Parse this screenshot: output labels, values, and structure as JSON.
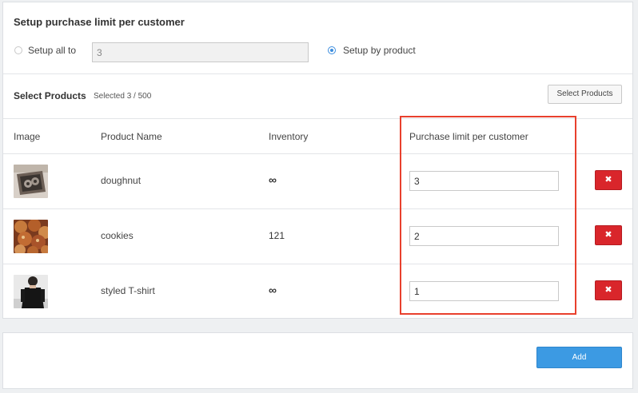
{
  "header": {
    "title": "Setup purchase limit per customer",
    "option_all_label": "Setup all to",
    "option_all_value": "3",
    "option_product_label": "Setup by product",
    "selected_option": "by_product"
  },
  "products": {
    "title": "Select Products",
    "count": "Selected 3 / 500",
    "select_button": "Select Products"
  },
  "table": {
    "columns": [
      "Image",
      "Product Name",
      "Inventory",
      "Purchase limit per customer"
    ],
    "rows": [
      {
        "name": "doughnut",
        "inventory": "∞",
        "limit": "3",
        "delete": "✖"
      },
      {
        "name": "cookies",
        "inventory": "121",
        "limit": "2",
        "delete": "✖"
      },
      {
        "name": "styled T-shirt",
        "inventory": "∞",
        "limit": "1",
        "delete": "✖"
      }
    ]
  },
  "footer": {
    "add_button": "Add"
  },
  "colors": {
    "accent_blue": "#3c9ae3",
    "delete_red": "#d9262b",
    "highlight_red": "#e8402d"
  }
}
